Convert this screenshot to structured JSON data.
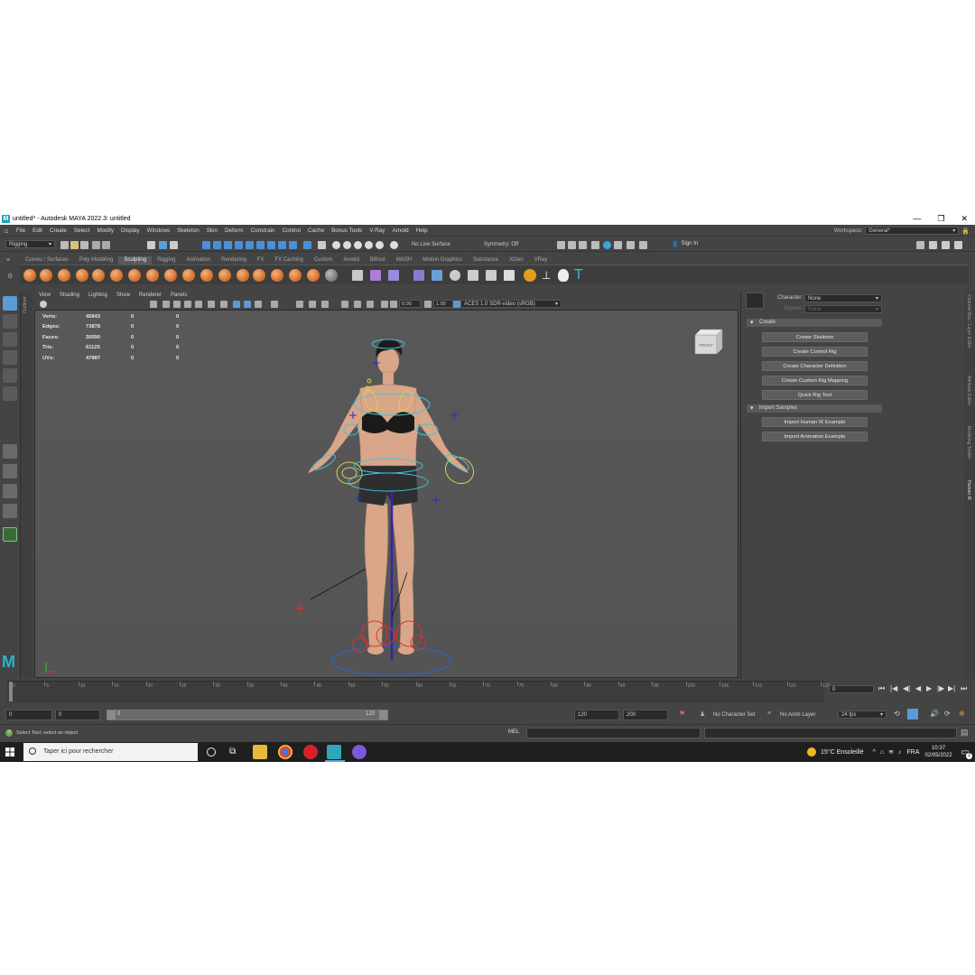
{
  "window": {
    "title": "untitled* - Autodesk MAYA 2022.3: untitled",
    "controls": [
      "—",
      "❐",
      "✕"
    ]
  },
  "menu": [
    "File",
    "Edit",
    "Create",
    "Select",
    "Modify",
    "Display",
    "Windows",
    "Skeleton",
    "Skin",
    "Deform",
    "Constrain",
    "Control",
    "Cache",
    "Bonus Tools",
    "V-Ray",
    "Arnold",
    "Help"
  ],
  "workspace": {
    "label": "Workspace:",
    "value": "General*"
  },
  "statusline": {
    "menuset": "Rigging",
    "live_surface": "No Live Surface",
    "symmetry": "Symmetry: Off",
    "sign_in": "Sign In"
  },
  "shelf_tabs": [
    "Curves / Surfaces",
    "Poly Modeling",
    "Sculpting",
    "Rigging",
    "Animation",
    "Rendering",
    "FX",
    "FX Caching",
    "Custom",
    "Arnold",
    "Bifrost",
    "MASH",
    "Motion Graphics",
    "Substance",
    "XGen",
    "VRay"
  ],
  "shelf_active": "Sculpting",
  "outliner_label": "Outliner",
  "viewport": {
    "menus": [
      "View",
      "Shading",
      "Lighting",
      "Show",
      "Renderer",
      "Panels"
    ],
    "exposure": "0.00",
    "gamma": "1.00",
    "color_space": "ACES 1.0 SDR-video (sRGB)",
    "viewcube_label": "FRONT",
    "hud": [
      {
        "label": "Verts:",
        "values": [
          "45843",
          "0",
          "0"
        ]
      },
      {
        "label": "Edges:",
        "values": [
          "73878",
          "0",
          "0"
        ]
      },
      {
        "label": "Faces:",
        "values": [
          "30590",
          "0",
          "0"
        ]
      },
      {
        "label": "Tris:",
        "values": [
          "61125",
          "0",
          "0"
        ]
      },
      {
        "label": "UVs:",
        "values": [
          "47887",
          "0",
          "0"
        ]
      }
    ]
  },
  "human_ik": {
    "character_label": "Character:",
    "character_value": "None",
    "source_label": "Source:",
    "source_value": "None",
    "create_section": "Create",
    "create_buttons": [
      "Create Skeleton",
      "Create Control Rig",
      "Create Character Definition",
      "Create Custom Rig Mapping",
      "Quick Rig Tool"
    ],
    "import_section": "Import Samples",
    "import_buttons": [
      "Import Human IK Example",
      "Import Animation Example"
    ]
  },
  "right_tabs": [
    "Channel Box / Layer Editor",
    "Attribute Editor",
    "Modeling Toolkit",
    "Human IK"
  ],
  "timeline": {
    "ticks": [
      "0",
      "5",
      "10",
      "15",
      "20",
      "25",
      "30",
      "35",
      "40",
      "45",
      "50",
      "55",
      "60",
      "65",
      "70",
      "75",
      "80",
      "85",
      "90",
      "95",
      "100",
      "105",
      "110",
      "115",
      "120"
    ],
    "current_frame": "0"
  },
  "range": {
    "start": "0",
    "anim_start": "0",
    "range_start": "0",
    "range_end": "120",
    "end": "120",
    "anim_end": "200",
    "character_set": "No Character Set",
    "anim_layer": "No Anim Layer",
    "fps": "24 fps"
  },
  "command_line": {
    "help_text": "Select Tool: select an object",
    "language": "MEL"
  },
  "taskbar": {
    "search_placeholder": "Taper ici pour rechercher",
    "weather": "15°C  Ensoleillé",
    "language": "FRA",
    "time": "10:37",
    "date": "02/05/2022",
    "notification_count": "2"
  },
  "colors": {
    "maya_teal": "#1fa5b8",
    "shelf_orange": "#e08040",
    "accent_blue": "#4a90d9"
  }
}
